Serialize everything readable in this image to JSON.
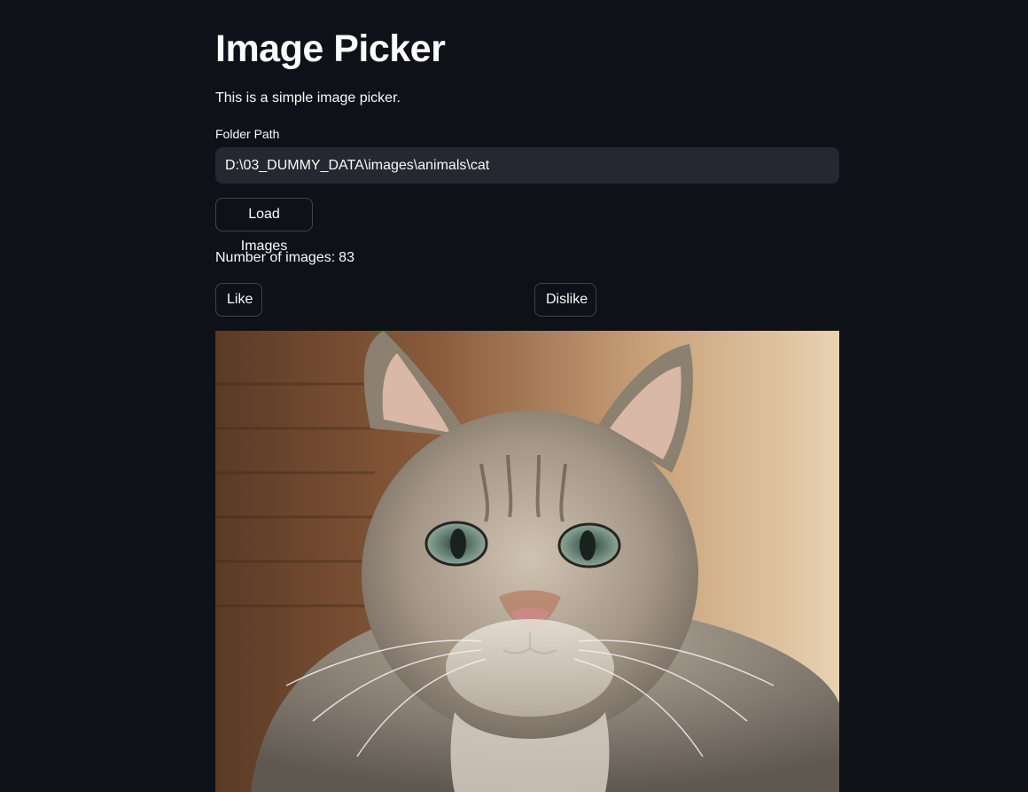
{
  "page": {
    "title": "Image Picker",
    "description": "This is a simple image picker."
  },
  "folder": {
    "label": "Folder Path",
    "value": "D:\\03_DUMMY_DATA\\images\\animals\\cat"
  },
  "buttons": {
    "load": "Load Images",
    "like": "Like",
    "dislike": "Dislike"
  },
  "stats": {
    "count_label": "Number of images:",
    "count_value": "83"
  },
  "colors": {
    "background": "#0e1117",
    "input_background": "#262730",
    "text": "#fafafa"
  },
  "image": {
    "subject": "cat-photo"
  }
}
